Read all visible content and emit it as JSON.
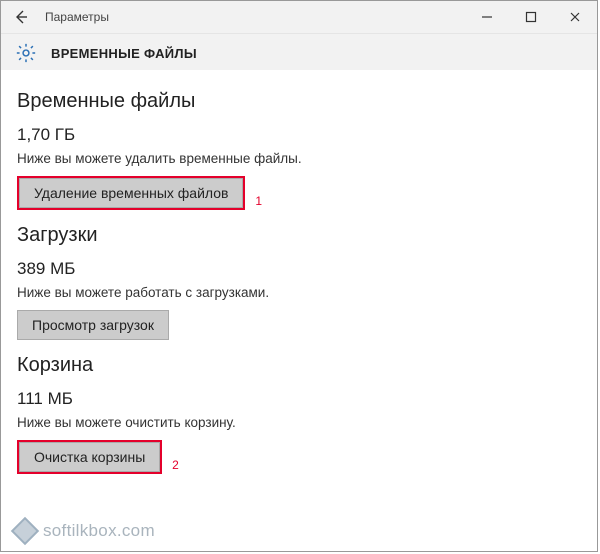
{
  "window": {
    "app_title": "Параметры",
    "page_title": "ВРЕМЕННЫЕ ФАЙЛЫ"
  },
  "sections": {
    "temp": {
      "heading": "Временные файлы",
      "size": "1,70 ГБ",
      "desc": "Ниже вы можете удалить временные файлы.",
      "button": "Удаление временных файлов",
      "annotation": "1"
    },
    "downloads": {
      "heading": "Загрузки",
      "size": "389 МБ",
      "desc": "Ниже вы можете работать с загрузками.",
      "button": "Просмотр загрузок"
    },
    "recycle": {
      "heading": "Корзина",
      "size": "111 МБ",
      "desc": "Ниже вы можете очистить корзину.",
      "button": "Очистка корзины",
      "annotation": "2"
    }
  },
  "watermark": "softilkbox.com"
}
